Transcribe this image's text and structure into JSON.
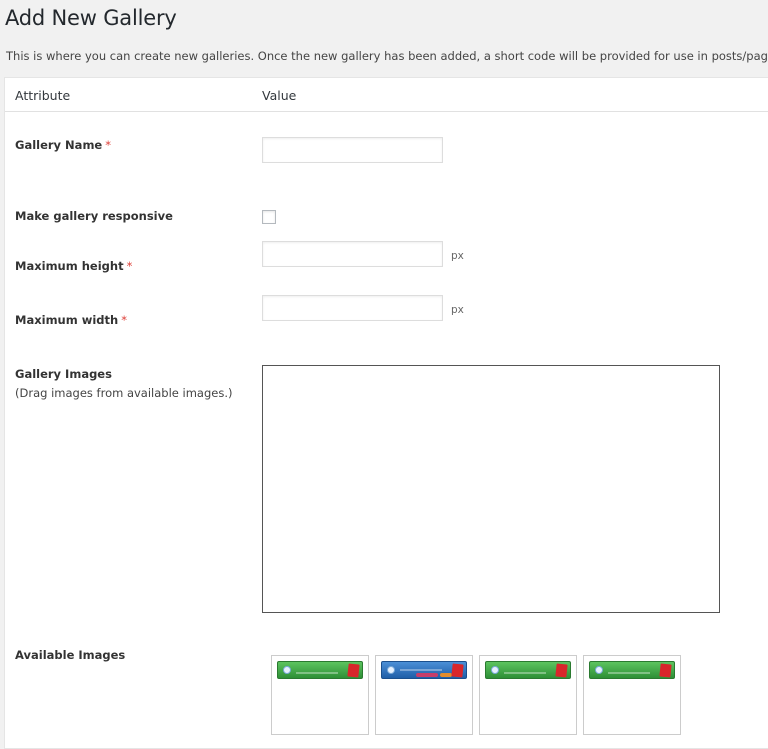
{
  "page": {
    "title": "Add New Gallery",
    "description": "This is where you can create new galleries. Once the new gallery has been added, a short code will be provided for use in posts/pages."
  },
  "table": {
    "headers": {
      "attribute": "Attribute",
      "value": "Value"
    }
  },
  "fields": {
    "gallery_name": {
      "label": "Gallery Name",
      "required_mark": "*",
      "value": "",
      "placeholder": ""
    },
    "responsive": {
      "label": "Make gallery responsive",
      "checked": false
    },
    "max_height": {
      "label": "Maximum height",
      "required_mark": "*",
      "value": "",
      "placeholder": "",
      "unit": "px"
    },
    "max_width": {
      "label": "Maximum width",
      "required_mark": "*",
      "value": "",
      "placeholder": "",
      "unit": "px"
    },
    "gallery_images": {
      "label": "Gallery Images",
      "hint": "(Drag images from available images.)"
    },
    "available_images": {
      "label": "Available Images",
      "items": [
        {
          "name": "xyz-classifieds-banner",
          "style": "green"
        },
        {
          "name": "xyz-email-manager-banner",
          "style": "blue"
        },
        {
          "name": "xyz-classifieds-banner",
          "style": "green"
        },
        {
          "name": "xyz-classifieds-banner",
          "style": "green"
        }
      ]
    }
  },
  "colors": {
    "required": "#dd3d36",
    "background": "#f1f1f1",
    "panel": "#ffffff"
  }
}
